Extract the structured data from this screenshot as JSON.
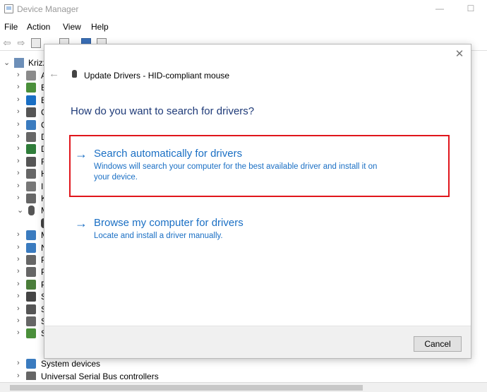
{
  "window": {
    "title": "Device Manager",
    "minimize_glyph": "—",
    "maximize_glyph": "☐"
  },
  "menu": {
    "items": [
      "File",
      "Action",
      "View",
      "Help"
    ]
  },
  "tree": {
    "root_label": "Krizz",
    "rows": [
      {
        "label": "A",
        "icon": "audio-icon",
        "color": "#8a8a8a"
      },
      {
        "label": "B",
        "icon": "battery-icon",
        "color": "#4a8f3a"
      },
      {
        "label": "B",
        "icon": "bluetooth-icon",
        "color": "#1a6fc4"
      },
      {
        "label": "C",
        "icon": "camera-icon",
        "color": "#555555"
      },
      {
        "label": "C",
        "icon": "computer-icon",
        "color": "#3a7bbf"
      },
      {
        "label": "D",
        "icon": "disk-drive-icon",
        "color": "#666666"
      },
      {
        "label": "D",
        "icon": "display-adapter-icon",
        "color": "#2f7d3a"
      },
      {
        "label": "F",
        "icon": "firmware-icon",
        "color": "#555555"
      },
      {
        "label": "H",
        "icon": "hid-icon",
        "color": "#666666"
      },
      {
        "label": "I",
        "icon": "ide-icon",
        "color": "#777777"
      },
      {
        "label": "K",
        "icon": "keyboard-icon",
        "color": "#666666"
      },
      {
        "label": "M",
        "icon": "mouse-icon",
        "color": "#555555"
      },
      {
        "label": "",
        "icon": "mouse-child-icon",
        "color": "#444444"
      },
      {
        "label": "M",
        "icon": "monitor-icon",
        "color": "#3a7bbf"
      },
      {
        "label": "N",
        "icon": "network-icon",
        "color": "#3a7bbf"
      },
      {
        "label": "P",
        "icon": "port-icon",
        "color": "#666666"
      },
      {
        "label": "P",
        "icon": "print-queue-icon",
        "color": "#666666"
      },
      {
        "label": "P",
        "icon": "processor-icon",
        "color": "#4a7d3a"
      },
      {
        "label": "S",
        "icon": "security-device-icon",
        "color": "#444444"
      },
      {
        "label": "S",
        "icon": "software-device-icon",
        "color": "#555555"
      },
      {
        "label": "S",
        "icon": "sound-icon",
        "color": "#666666"
      },
      {
        "label": "S",
        "icon": "storage-icon",
        "color": "#4a8f3a"
      }
    ],
    "system_devices": "System devices",
    "usb_controllers": "Universal Serial Bus controllers"
  },
  "dialog": {
    "title": "Update Drivers - HID-compliant mouse",
    "close_glyph": "✕",
    "back_glyph": "←",
    "question": "How do you want to search for drivers?",
    "options": [
      {
        "title": "Search automatically for drivers",
        "description": "Windows will search your computer for the best available driver and install it on your device.",
        "highlighted": true,
        "highlight_color": "#e0161c"
      },
      {
        "title": "Browse my computer for drivers",
        "description": "Locate and install a driver manually.",
        "highlighted": false
      }
    ],
    "arrow_glyph": "→",
    "cancel_label": "Cancel",
    "link_color": "#1a6fc4"
  }
}
